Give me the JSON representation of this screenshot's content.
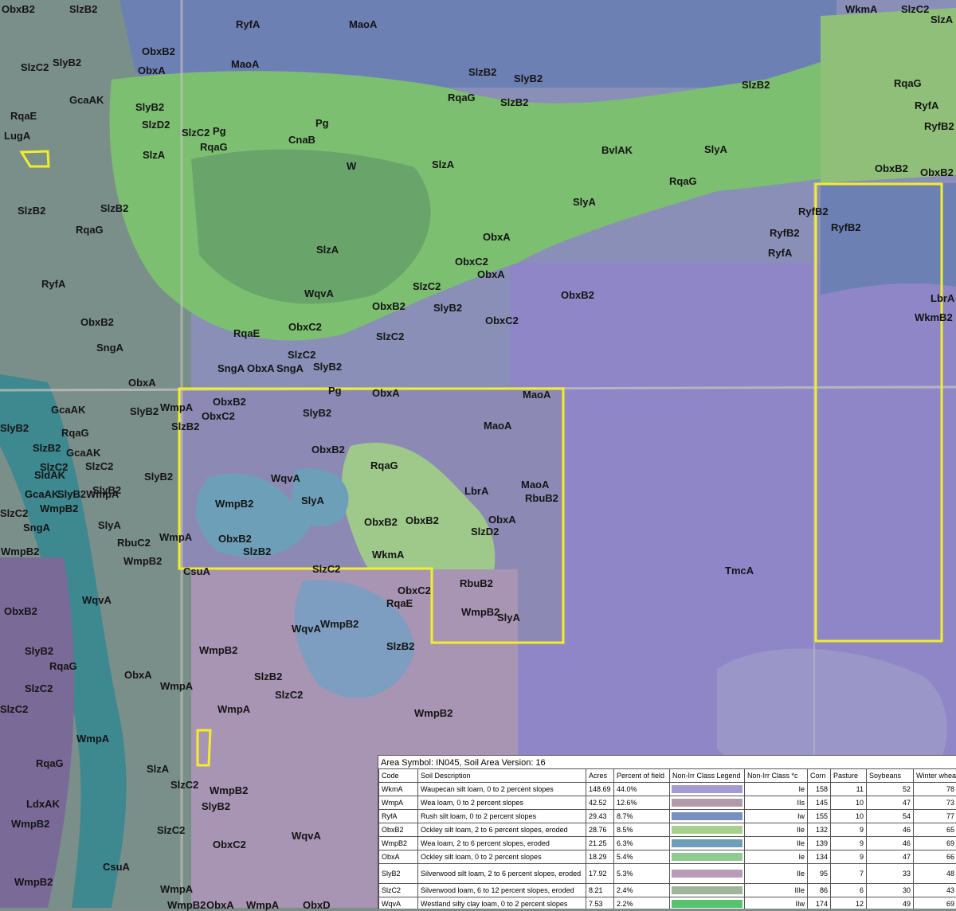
{
  "map": {
    "labels": [
      "ObxB2",
      "SlzB2",
      "ObxB2",
      "ObxA",
      "SlyB2",
      "SlzC2",
      "RyfA",
      "MaoA",
      "MaoA",
      "SlzB2",
      "SlyB2",
      "RqaG",
      "SlzB2",
      "SlzB2",
      "WkmA",
      "SlzC2",
      "SlzA",
      "RqaG",
      "RyfA",
      "RyfB2",
      "ObxB2",
      "ObxB2",
      "GcaAK",
      "SlyB2",
      "RqaE",
      "SlzD2",
      "LugA",
      "SlzC2",
      "Pg",
      "RqaG",
      "Pg",
      "CnaB",
      "SlzA",
      "W",
      "SlzA",
      "BvlAK",
      "SlyA",
      "RqaG",
      "SlyA",
      "RyfB2",
      "RyfB2",
      "RyfB2",
      "RyfA",
      "SlzB2",
      "SlzB2",
      "RqaG",
      "SlzA",
      "ObxA",
      "ObxC2",
      "ObxA",
      "RyfA",
      "WqvA",
      "SlzC2",
      "ObxB2",
      "SlyB2",
      "ObxB2",
      "LbrA",
      "WkmB2",
      "ObxC2",
      "ObxB2",
      "SlzC2",
      "RqaE",
      "ObxC2",
      "SngA",
      "SlzC2",
      "SngA",
      "ObxA",
      "SngA",
      "SlyB2",
      "Pg",
      "ObxA",
      "ObxA",
      "MaoA",
      "ObxB2",
      "GcaAK",
      "SlyB2",
      "WmpA",
      "ObxC2",
      "SlzB2",
      "SlyB2",
      "MaoA",
      "SlyB2",
      "RqaG",
      "SlzB2",
      "GcaAK",
      "SlzC2",
      "SlzC2",
      "SldAK",
      "SlyB2",
      "SlyB2",
      "ObxB2",
      "RqaG",
      "GcaAK",
      "SlyB2WmpA",
      "WqvA",
      "LbrA",
      "MaoA",
      "RbuB2",
      "SlzC2",
      "WmpB2",
      "WmpB2",
      "SlyA",
      "SngA",
      "ObxB2",
      "ObxB2",
      "SlzD2",
      "SlyA",
      "WmpA",
      "ObxB2",
      "ObxA",
      "RbuC2",
      "WmpB2",
      "SlzB2",
      "WmpB2",
      "CsuA",
      "SlzC2",
      "WkmA",
      "TmcA",
      "ObxC2",
      "RqaE",
      "WqvA",
      "RbuB2",
      "ObxB2",
      "WmpB2",
      "SlyA",
      "WqvA",
      "WmpB2",
      "SlzB2",
      "SlyB2",
      "WmpB2",
      "RqaG",
      "ObxA",
      "WmpA",
      "SlzB2",
      "SlzC2",
      "SlzC2",
      "SlzC2",
      "WmpA",
      "WmpA",
      "WmpB2",
      "RqaG",
      "SlzA",
      "SlzC2",
      "WmpB2",
      "LdxAK",
      "SlyB2",
      "WmpB2",
      "SlzC2",
      "ObxC2",
      "WqvA",
      "CsuA",
      "WmpB2",
      "WmpA",
      "WmpB2",
      "ObxA",
      "WmpA",
      "ObxD"
    ],
    "highlight_color": "#f2ee2a"
  },
  "legend": {
    "title": "Area Symbol: IN045, Soil Area Version: 16",
    "headers": [
      "Code",
      "Soil Description",
      "Acres",
      "Percent of field",
      "Non-Irr Class Legend",
      "Non-Irr Class *c",
      "Corn",
      "Pasture",
      "Soybeans",
      "Winter wheat"
    ],
    "rows": [
      {
        "code": "WkmA",
        "desc": "Waupecan silt loam, 0 to 2 percent slopes",
        "acres": "148.69",
        "pct": "44.0%",
        "color": "#a49bd3",
        "cls": "Ie",
        "corn": "158",
        "pasture": "11",
        "soy": "52",
        "wheat": "78"
      },
      {
        "code": "WmpA",
        "desc": "Wea loam, 0 to 2 percent slopes",
        "acres": "42.52",
        "pct": "12.6%",
        "color": "#b39aa9",
        "cls": "IIs",
        "corn": "145",
        "pasture": "10",
        "soy": "47",
        "wheat": "73"
      },
      {
        "code": "RyfA",
        "desc": "Rush silt loam, 0 to 2 percent slopes",
        "acres": "29.43",
        "pct": "8.7%",
        "color": "#7891c2",
        "cls": "Iw",
        "corn": "155",
        "pasture": "10",
        "soy": "54",
        "wheat": "77"
      },
      {
        "code": "ObxB2",
        "desc": "Ockley silt loam, 2 to 6 percent slopes, eroded",
        "acres": "28.76",
        "pct": "8.5%",
        "color": "#a7d08a",
        "cls": "IIe",
        "corn": "132",
        "pasture": "9",
        "soy": "46",
        "wheat": "65"
      },
      {
        "code": "WmpB2",
        "desc": "Wea loam, 2 to 6 percent slopes, eroded",
        "acres": "21.25",
        "pct": "6.3%",
        "color": "#6e9fb9",
        "cls": "IIe",
        "corn": "139",
        "pasture": "9",
        "soy": "46",
        "wheat": "69"
      },
      {
        "code": "ObxA",
        "desc": "Ockley silt loam, 0 to 2 percent slopes",
        "acres": "18.29",
        "pct": "5.4%",
        "color": "#8fcc92",
        "cls": "Ie",
        "corn": "134",
        "pasture": "9",
        "soy": "47",
        "wheat": "66"
      },
      {
        "code": "SlyB2",
        "desc": "Silverwood silt loam, 2 to 6 percent slopes, eroded",
        "acres": "17.92",
        "pct": "5.3%",
        "color": "#b89ab9",
        "cls": "IIe",
        "corn": "95",
        "pasture": "7",
        "soy": "33",
        "wheat": "48"
      },
      {
        "code": "SlzC2",
        "desc": "Silverwood loam, 6 to 12 percent slopes, eroded",
        "acres": "8.21",
        "pct": "2.4%",
        "color": "#9eb59a",
        "cls": "IIIe",
        "corn": "86",
        "pasture": "6",
        "soy": "30",
        "wheat": "43"
      },
      {
        "code": "WqvA",
        "desc": "Westland silty clay loam, 0 to 2 percent slopes",
        "acres": "7.53",
        "pct": "2.2%",
        "color": "#55c46c",
        "cls": "IIw",
        "corn": "174",
        "pasture": "12",
        "soy": "49",
        "wheat": "69"
      }
    ]
  }
}
